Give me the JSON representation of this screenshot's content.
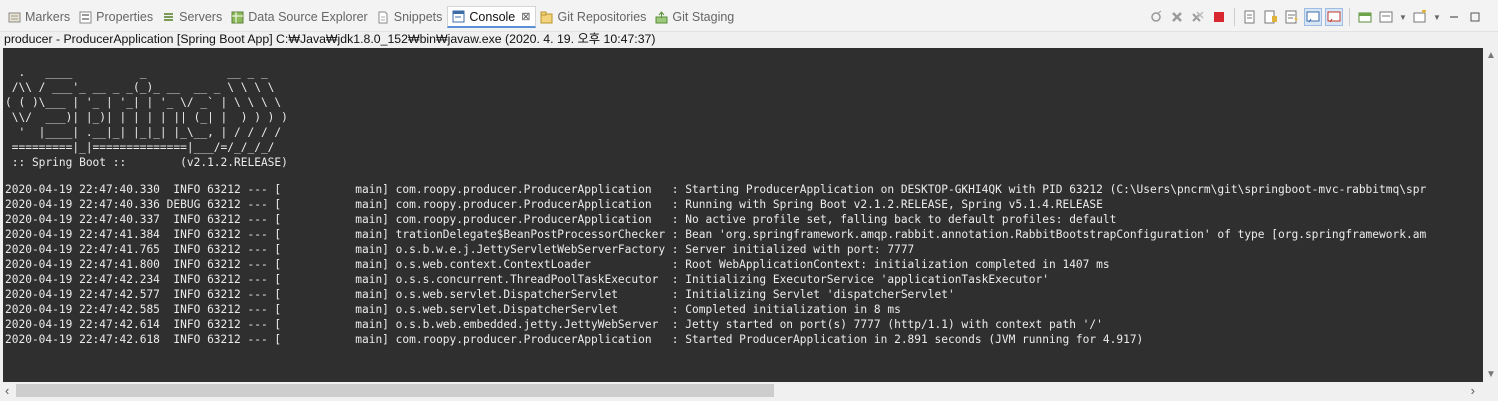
{
  "tabs": [
    {
      "label": "Markers",
      "icon": "markers-icon",
      "active": false
    },
    {
      "label": "Properties",
      "icon": "properties-icon",
      "active": false
    },
    {
      "label": "Servers",
      "icon": "servers-icon",
      "active": false
    },
    {
      "label": "Data Source Explorer",
      "icon": "data-source-icon",
      "active": false
    },
    {
      "label": "Snippets",
      "icon": "snippets-icon",
      "active": false
    },
    {
      "label": "Console",
      "icon": "console-icon",
      "active": true,
      "close": "⊠"
    },
    {
      "label": "Git Repositories",
      "icon": "git-repositories-icon",
      "active": false
    },
    {
      "label": "Git Staging",
      "icon": "git-staging-icon",
      "active": false
    }
  ],
  "process_line": "producer - ProducerApplication [Spring Boot App] C:₩Java₩jdk1.8.0_152₩bin₩javaw.exe (2020. 4. 19. 오후 10:47:37)",
  "banner": [
    "  .   ____          _            __ _ _",
    " /\\\\ / ___'_ __ _ _(_)_ __  __ _ \\ \\ \\ \\",
    "( ( )\\___ | '_ | '_| | '_ \\/ _` | \\ \\ \\ \\",
    " \\\\/  ___)| |_)| | | | | || (_| |  ) ) ) )",
    "  '  |____| .__|_| |_|_| |_\\__, | / / / /",
    " =========|_|==============|___/=/_/_/_/",
    " :: Spring Boot ::        (v2.1.2.RELEASE)"
  ],
  "logs": [
    "2020-04-19 22:47:40.330  INFO 63212 --- [           main] com.roopy.producer.ProducerApplication   : Starting ProducerApplication on DESKTOP-GKHI4QK with PID 63212 (C:\\Users\\pncrm\\git\\springboot-mvc-rabbitmq\\spr",
    "2020-04-19 22:47:40.336 DEBUG 63212 --- [           main] com.roopy.producer.ProducerApplication   : Running with Spring Boot v2.1.2.RELEASE, Spring v5.1.4.RELEASE",
    "2020-04-19 22:47:40.337  INFO 63212 --- [           main] com.roopy.producer.ProducerApplication   : No active profile set, falling back to default profiles: default",
    "2020-04-19 22:47:41.384  INFO 63212 --- [           main] trationDelegate$BeanPostProcessorChecker : Bean 'org.springframework.amqp.rabbit.annotation.RabbitBootstrapConfiguration' of type [org.springframework.am",
    "2020-04-19 22:47:41.765  INFO 63212 --- [           main] o.s.b.w.e.j.JettyServletWebServerFactory : Server initialized with port: 7777",
    "2020-04-19 22:47:41.800  INFO 63212 --- [           main] o.s.web.context.ContextLoader            : Root WebApplicationContext: initialization completed in 1407 ms",
    "2020-04-19 22:47:42.234  INFO 63212 --- [           main] o.s.s.concurrent.ThreadPoolTaskExecutor  : Initializing ExecutorService 'applicationTaskExecutor'",
    "2020-04-19 22:47:42.577  INFO 63212 --- [           main] o.s.web.servlet.DispatcherServlet        : Initializing Servlet 'dispatcherServlet'",
    "2020-04-19 22:47:42.585  INFO 63212 --- [           main] o.s.web.servlet.DispatcherServlet        : Completed initialization in 8 ms",
    "2020-04-19 22:47:42.614  INFO 63212 --- [           main] o.s.b.web.embedded.jetty.JettyWebServer  : Jetty started on port(s) 7777 (http/1.1) with context path '/'",
    "2020-04-19 22:47:42.618  INFO 63212 --- [           main] com.roopy.producer.ProducerApplication   : Started ProducerApplication in 2.891 seconds (JVM running for 4.917)"
  ],
  "toolbar_icons": [
    "pin-console-icon",
    "terminate-icon",
    "remove-all-terminated-icon",
    "stop-icon",
    "clear-console-icon",
    "scroll-lock-icon",
    "word-wrap-icon",
    "show-on-stdout-icon",
    "show-on-stderr-icon",
    "display-selected-console-icon",
    "open-console-icon",
    "new-console-view-icon",
    "minimize-icon",
    "maximize-icon"
  ],
  "colors": {
    "console_bg": "#2f2f2f",
    "console_text": "#ececec",
    "active_tab_accent": "#5a8fd6",
    "stop_red": "#d8272e"
  }
}
